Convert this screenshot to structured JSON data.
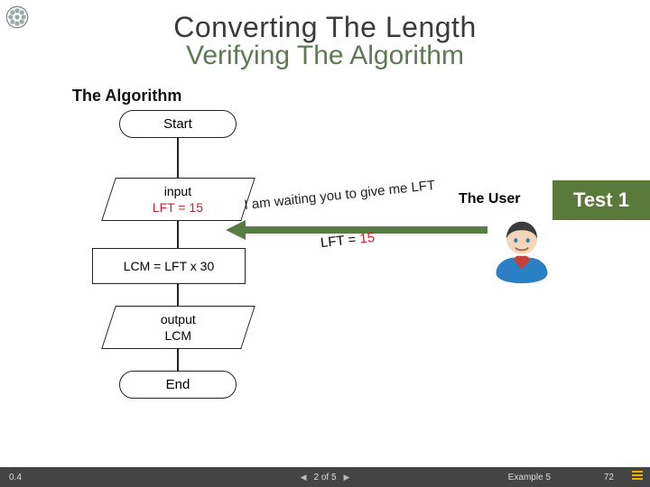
{
  "title": {
    "line1": "Converting The Length",
    "line2": "Verifying The Algorithm"
  },
  "subtitle": "The Algorithm",
  "flow": {
    "start": "Start",
    "input_lbl": "input",
    "input_val": "LFT = 15",
    "process": "LCM = LFT x 30",
    "output_lbl": "output",
    "output_val": "LCM",
    "end": "End"
  },
  "right": {
    "wait_msg": "I am waiting you to give me LFT",
    "lft_lbl": "LFT = ",
    "lft_val": "15",
    "user_lbl": "The User",
    "test_badge": "Test 1"
  },
  "footer": {
    "version": "0.4",
    "pager": "2 of 5",
    "example": "Example 5",
    "page_num": "72"
  }
}
